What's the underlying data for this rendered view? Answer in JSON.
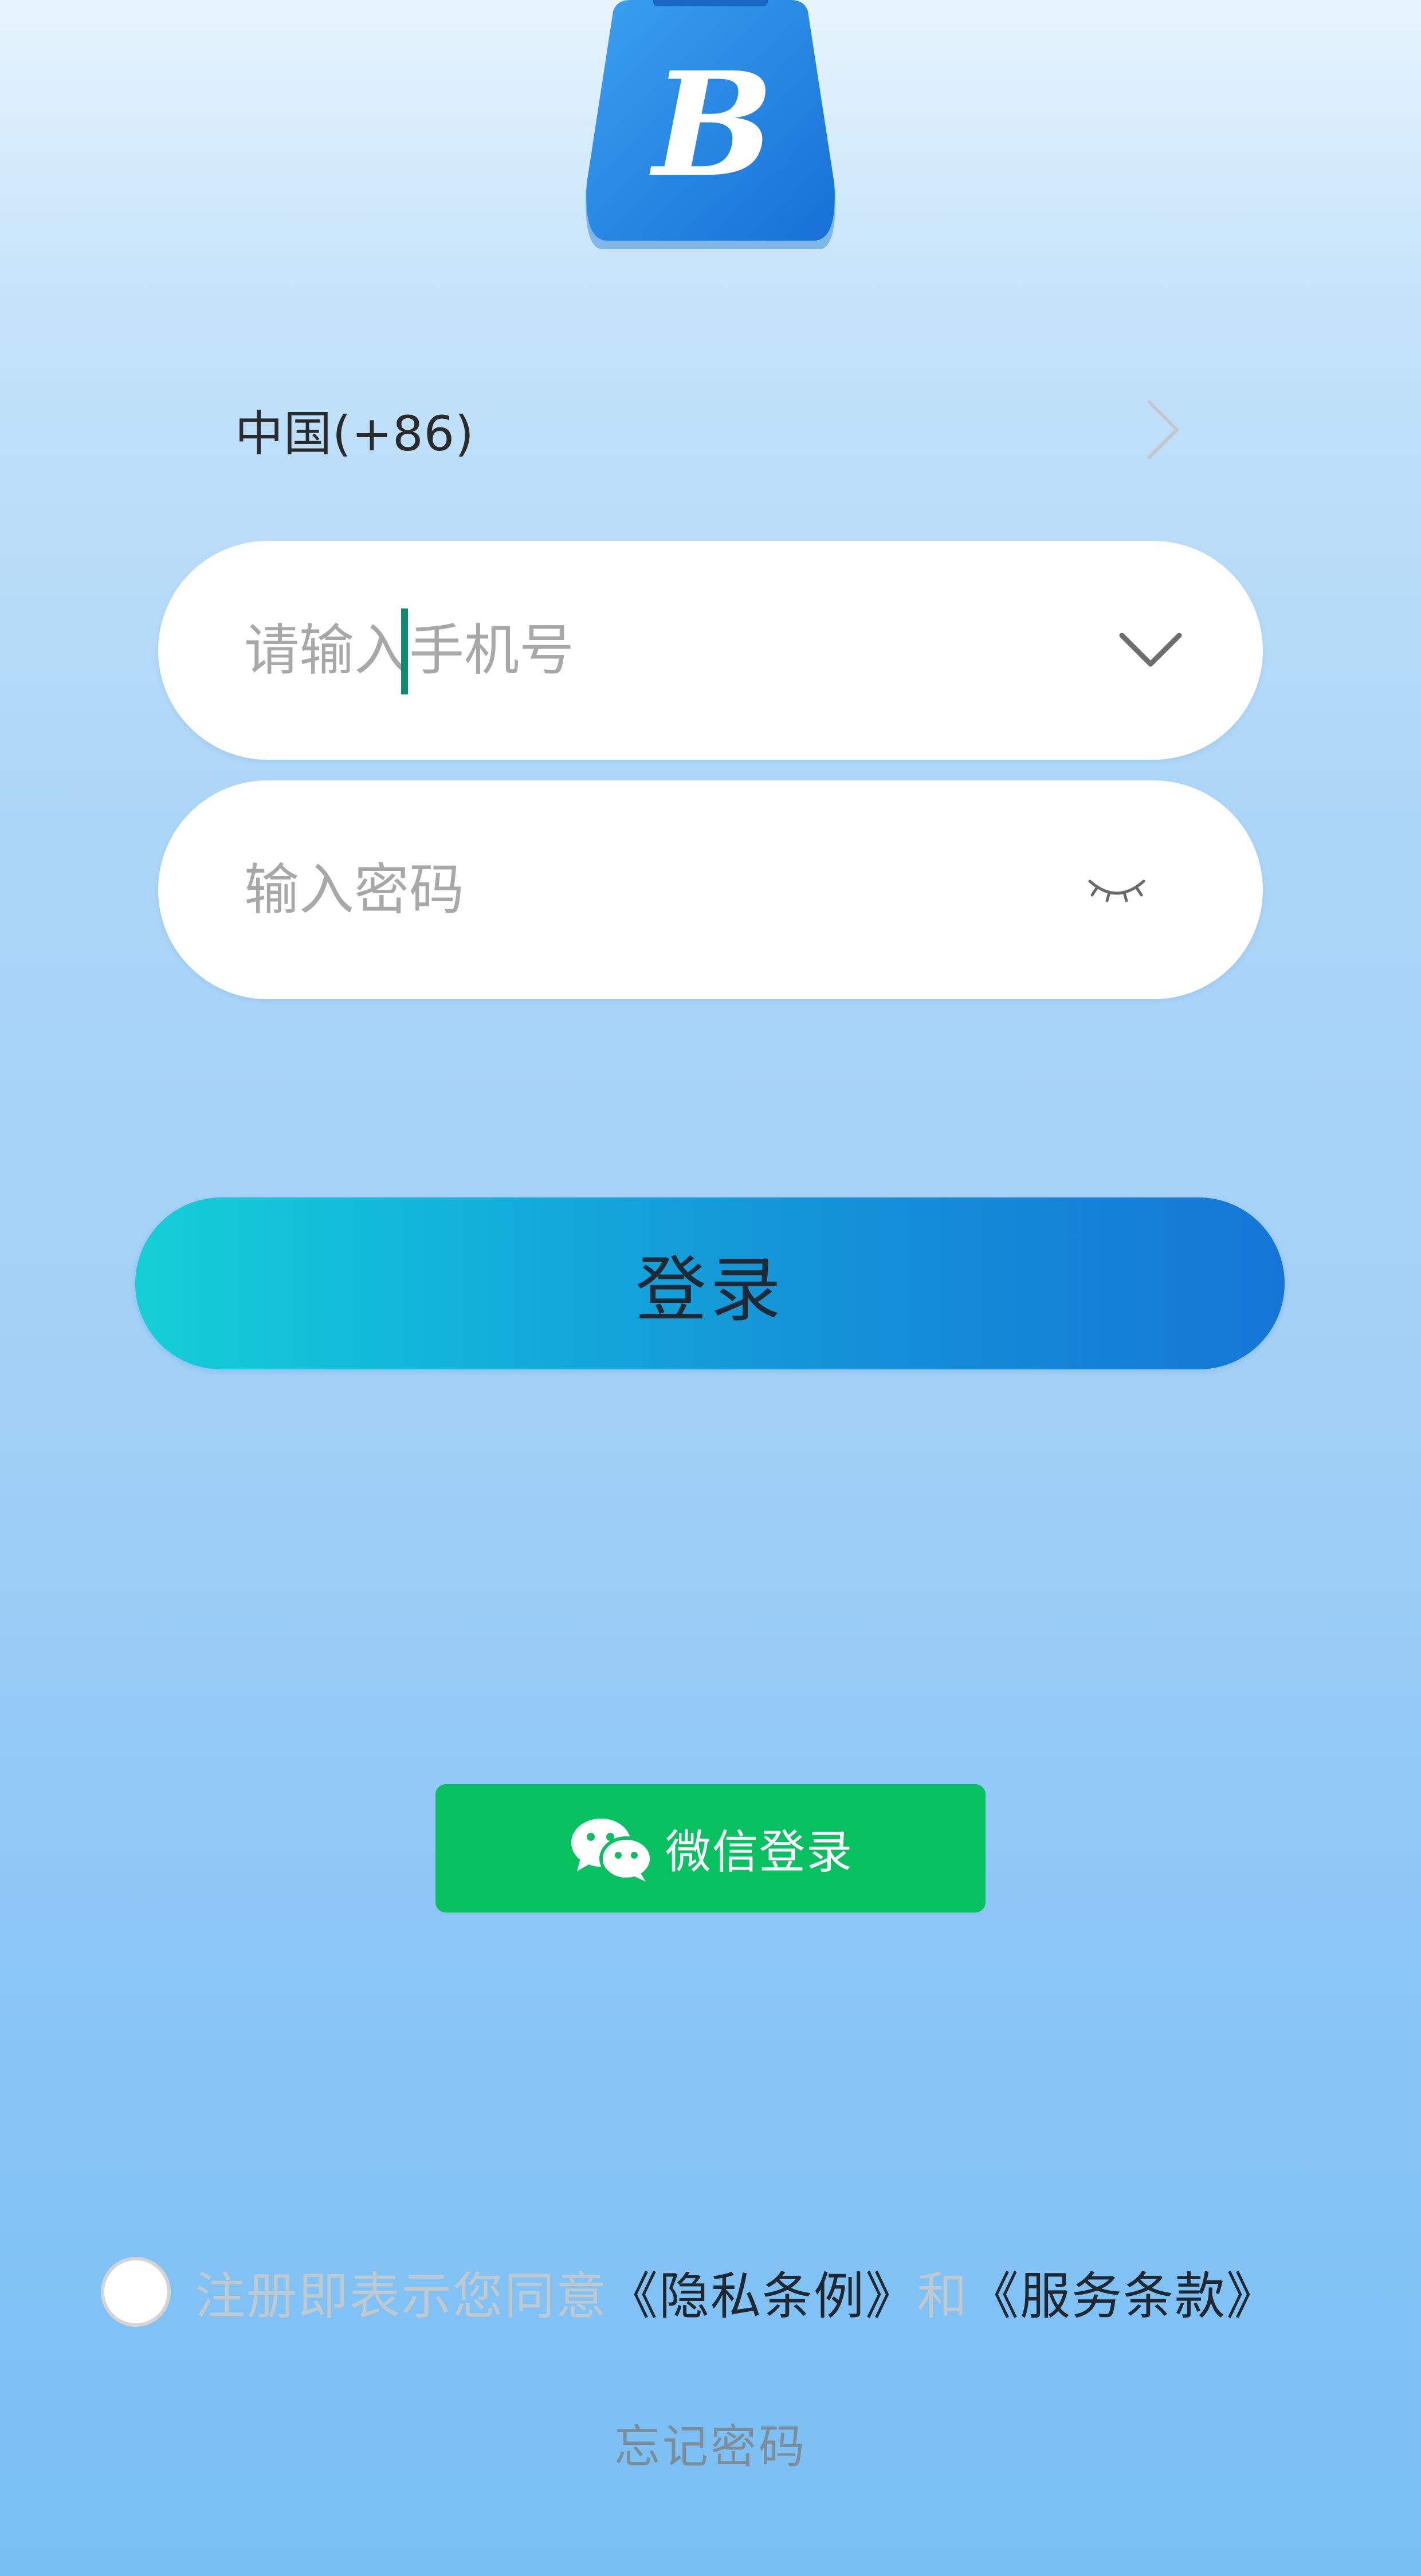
{
  "logo": {
    "letter": "B",
    "icon": "shopping-bag-logo",
    "color": "#1e88e5"
  },
  "country": {
    "label": "中国(+86)",
    "icon": "chevron-right-icon"
  },
  "phone_field": {
    "value": "",
    "placeholder": "请输入手机号",
    "icon": "chevron-down-icon"
  },
  "password_field": {
    "value": "",
    "placeholder": "输入密码",
    "icon": "eye-closed-icon"
  },
  "login_button": {
    "label": "登录",
    "gradient_start": "#15cfd6",
    "gradient_end": "#1576d6"
  },
  "wechat_button": {
    "label": "微信登录",
    "icon": "wechat-icon",
    "color": "#07c160"
  },
  "agreement": {
    "checked": false,
    "prefix": "注册即表示您同意",
    "privacy_link": "《隐私条例》",
    "conjunction": "和",
    "terms_link": "《服务条款》"
  },
  "forgot_password": {
    "label": "忘记密码"
  }
}
